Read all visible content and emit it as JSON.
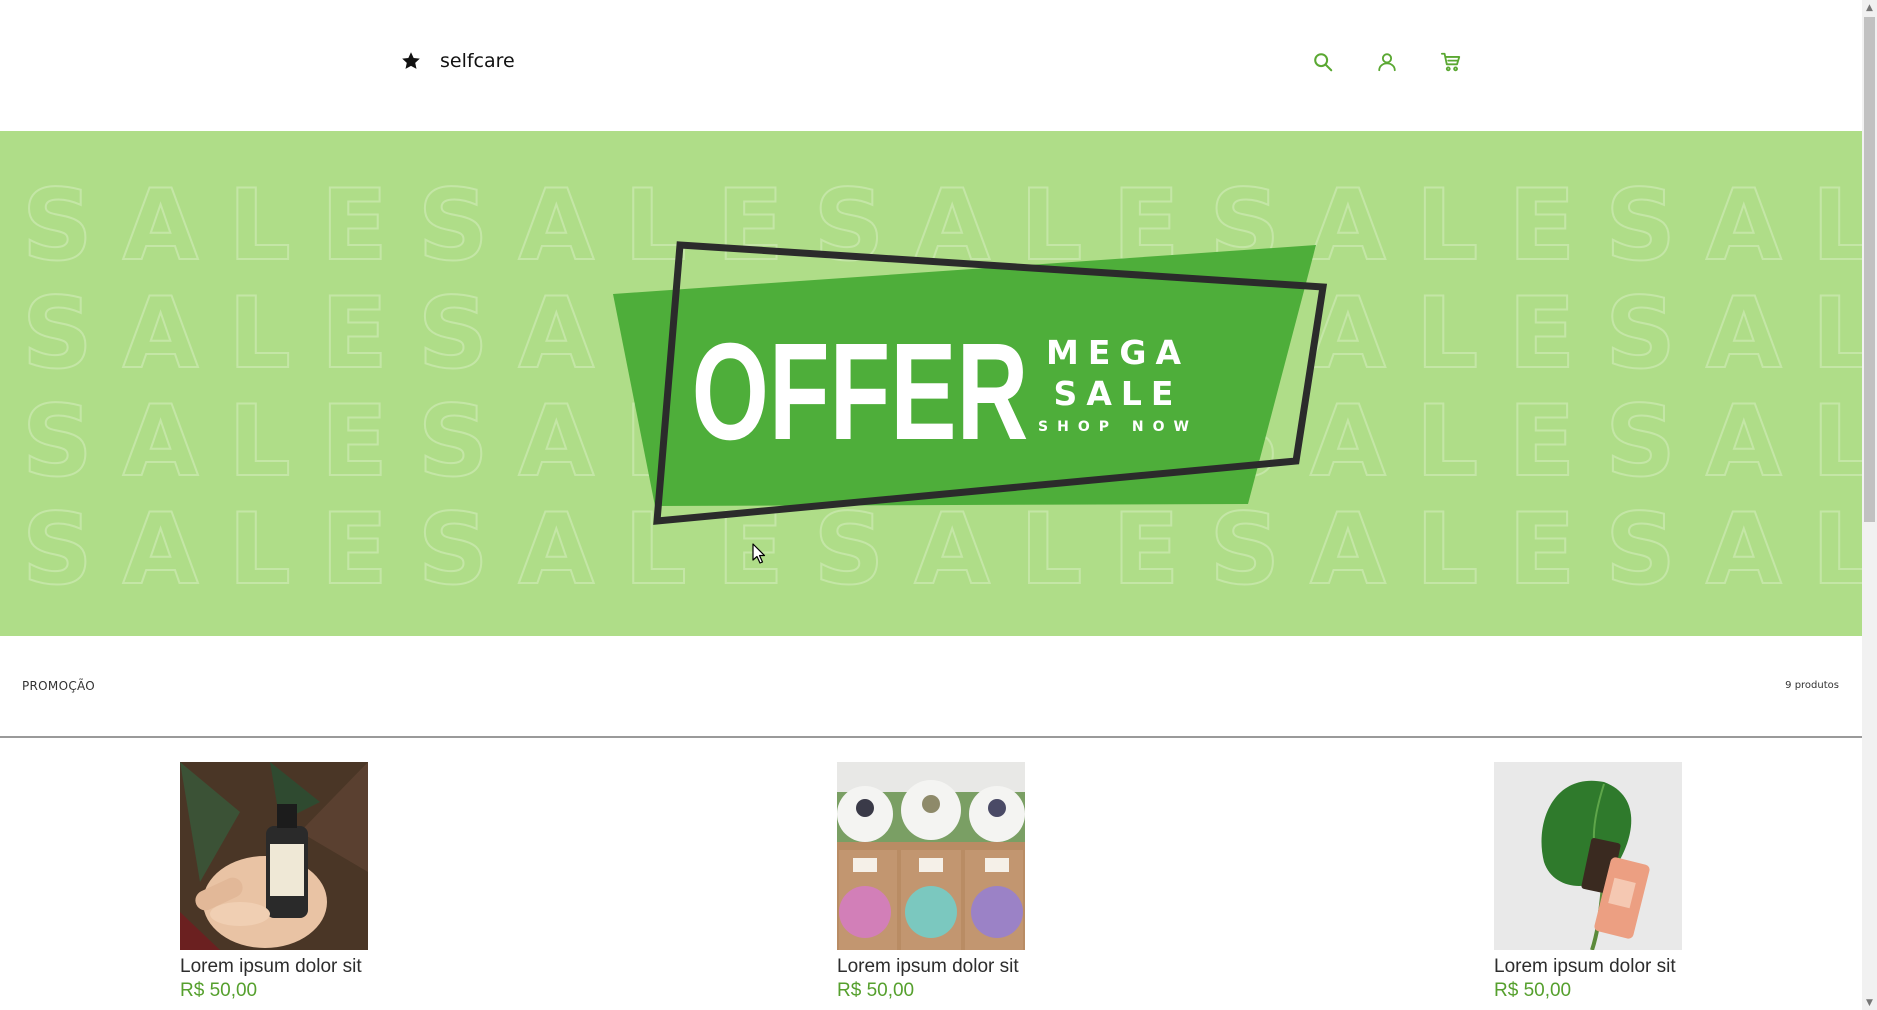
{
  "brand": {
    "name": "selfcare",
    "icon": "star-icon"
  },
  "header": {
    "actions": [
      {
        "name": "search",
        "icon": "search-icon"
      },
      {
        "name": "account",
        "icon": "user-icon"
      },
      {
        "name": "cart",
        "icon": "cart-icon"
      }
    ],
    "accent_color": "#5aa832"
  },
  "hero": {
    "background_word": "SALE",
    "offer": "OFFER",
    "mega": "MEGA",
    "sale": "SALE",
    "cta": "SHOP NOW",
    "background_color": "#afdd88",
    "banner_color": "#4eae3a",
    "frame_color": "#2b2b2b"
  },
  "section": {
    "title": "PROMOÇÃO",
    "count": "9 produtos"
  },
  "products": [
    {
      "name": "Lorem ipsum dolor sit",
      "price": "R$ 50,00",
      "image": "serum-bottle-in-hand"
    },
    {
      "name": "Lorem ipsum dolor sit",
      "price": "R$ 50,00",
      "image": "bath-bombs-boxes"
    },
    {
      "name": "Lorem ipsum dolor sit",
      "price": "R$ 50,00",
      "image": "leaf-with-cosmetic-bottle"
    }
  ],
  "price_color": "#56a02e"
}
